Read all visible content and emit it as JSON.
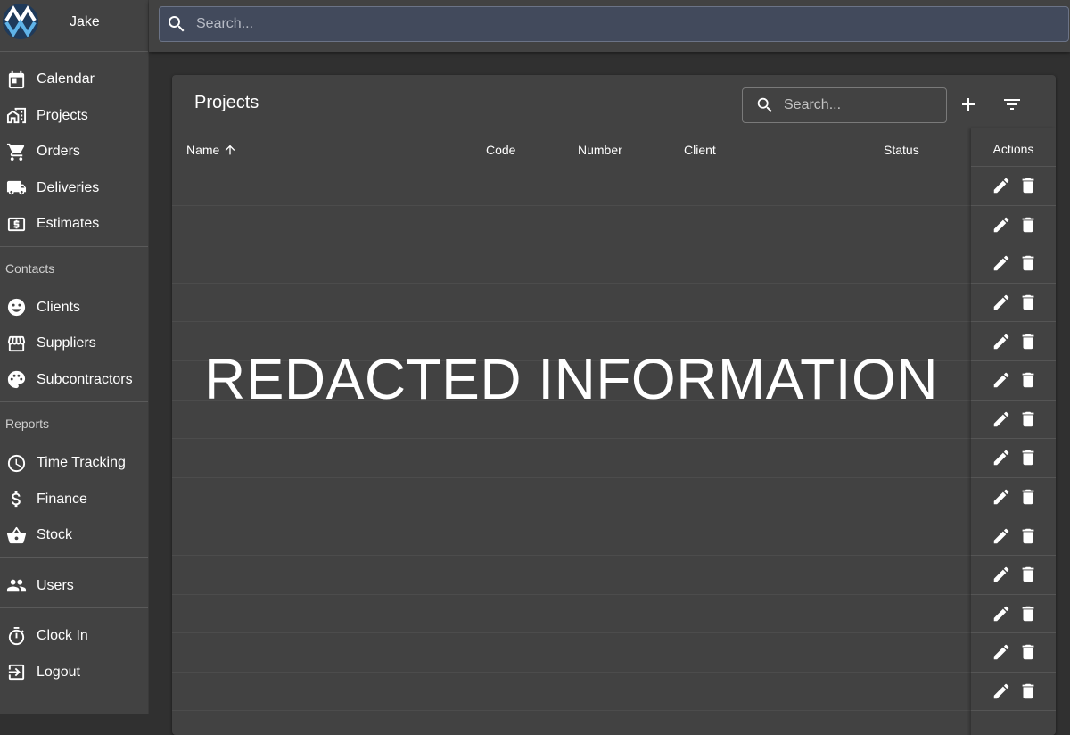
{
  "sidebar": {
    "user_name": "Jake",
    "main_items": [
      {
        "label": "Calendar",
        "icon": "calendar-icon"
      },
      {
        "label": "Projects",
        "icon": "projects-icon"
      },
      {
        "label": "Orders",
        "icon": "cart-icon"
      },
      {
        "label": "Deliveries",
        "icon": "truck-icon"
      },
      {
        "label": "Estimates",
        "icon": "estimate-icon"
      }
    ],
    "contacts_header": "Contacts",
    "contacts_items": [
      {
        "label": "Clients",
        "icon": "smiley-icon"
      },
      {
        "label": "Suppliers",
        "icon": "store-icon"
      },
      {
        "label": "Subcontractors",
        "icon": "palette-icon"
      }
    ],
    "reports_header": "Reports",
    "reports_items": [
      {
        "label": "Time Tracking",
        "icon": "clock-icon"
      },
      {
        "label": "Finance",
        "icon": "dollar-icon"
      },
      {
        "label": "Stock",
        "icon": "basket-icon"
      }
    ],
    "admin_items": [
      {
        "label": "Users",
        "icon": "users-icon"
      }
    ],
    "footer_items": [
      {
        "label": "Clock In",
        "icon": "timer-icon"
      },
      {
        "label": "Logout",
        "icon": "logout-icon"
      }
    ]
  },
  "topbar": {
    "search_placeholder": "Search..."
  },
  "projects": {
    "title": "Projects",
    "search_placeholder": "Search...",
    "columns": {
      "name": "Name",
      "code": "Code",
      "number": "Number",
      "client": "Client",
      "status": "Status",
      "actions": "Actions"
    },
    "sort": {
      "column": "Name",
      "direction": "ascending"
    },
    "visible_row_count": 14,
    "redacted_text": "REDACTED INFORMATION"
  },
  "colors": {
    "background": "#303030",
    "surface": "#424242",
    "search_bg": "#424a5c",
    "text": "#ffffff"
  }
}
